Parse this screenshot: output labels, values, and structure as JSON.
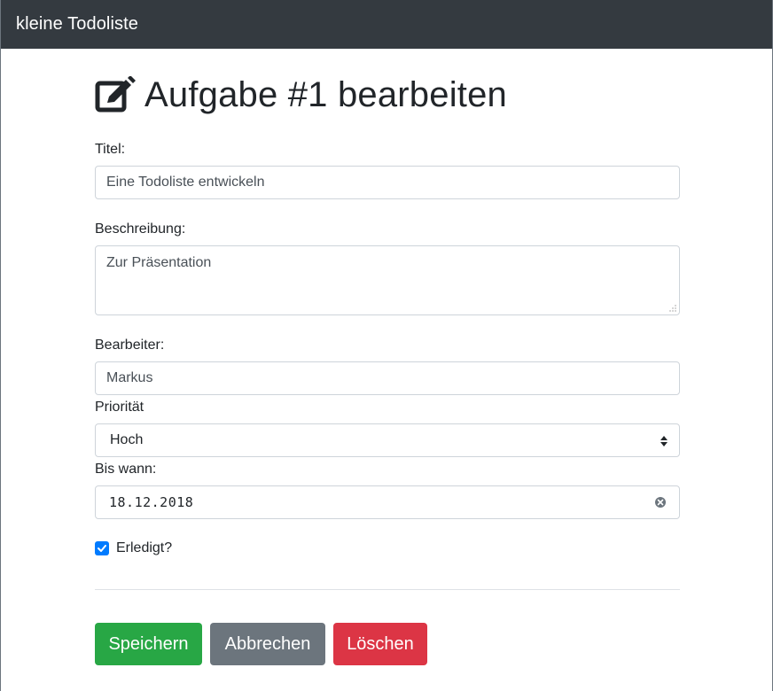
{
  "navbar": {
    "brand": "kleine Todoliste"
  },
  "page": {
    "title": "Aufgabe #1 bearbeiten",
    "icon": "edit-icon"
  },
  "form": {
    "title_label": "Titel:",
    "title_value": "Eine Todoliste entwickeln",
    "description_label": "Beschreibung:",
    "description_value": "Zur Präsentation",
    "assignee_label": "Bearbeiter:",
    "assignee_value": "Markus",
    "priority_label": "Priorität",
    "priority_value": "Hoch",
    "due_label": "Bis wann:",
    "due_value": "18.12.2018",
    "done_label": "Erledigt?",
    "done_checked": true
  },
  "buttons": {
    "save": "Speichern",
    "cancel": "Abbrechen",
    "delete": "Löschen"
  },
  "colors": {
    "navbar": "#343a40",
    "save": "#28a745",
    "cancel": "#6c757d",
    "delete": "#dc3545",
    "checkbox": "#007bff"
  }
}
